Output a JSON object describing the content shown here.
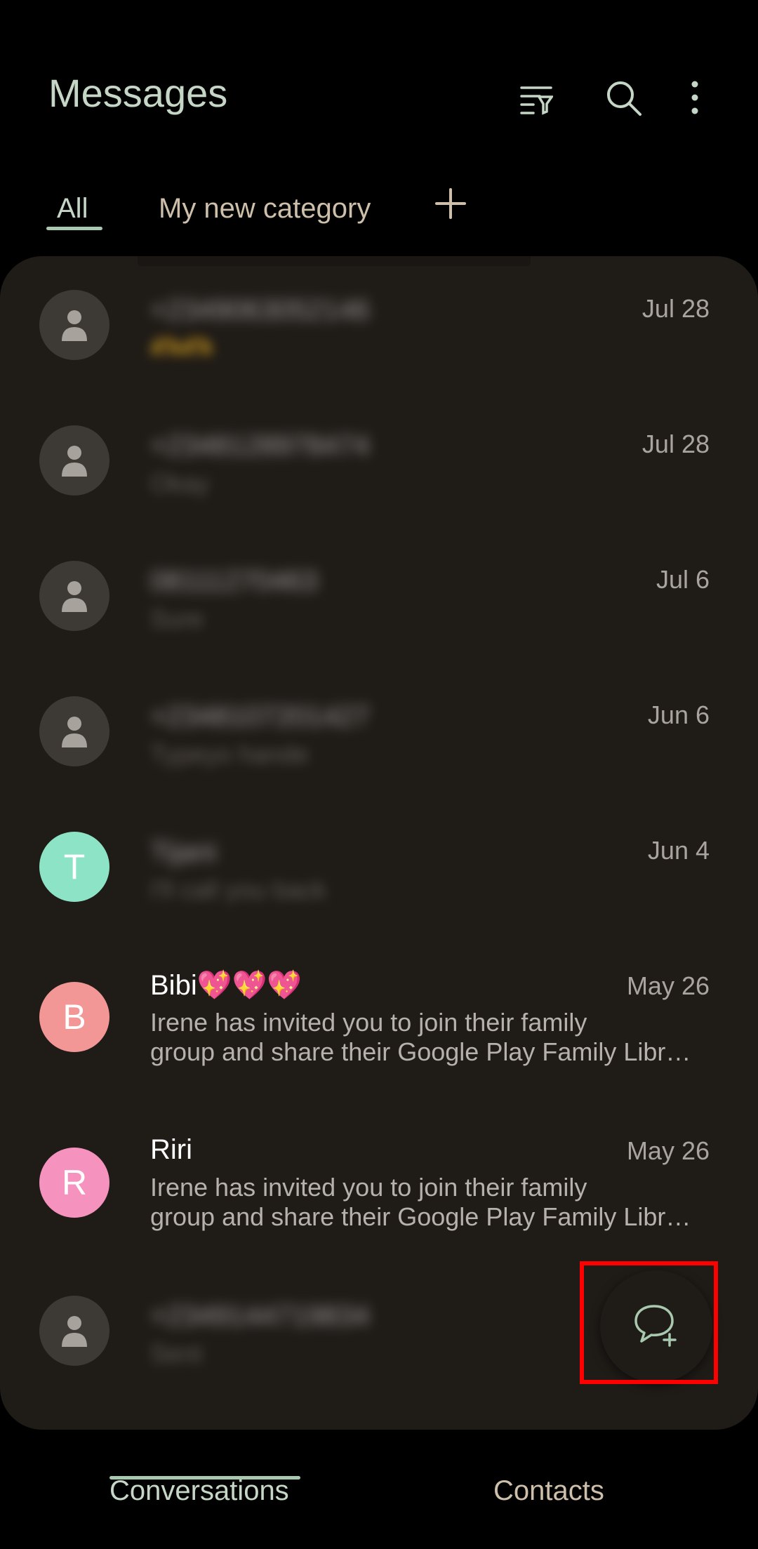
{
  "header": {
    "title": "Messages",
    "icons": [
      "filter-icon",
      "search-icon",
      "more-options-icon"
    ]
  },
  "tabs": [
    {
      "label": "All",
      "active": true
    },
    {
      "label": "My new category",
      "active": false
    }
  ],
  "add_category_icon": "plus-icon",
  "conversations": [
    {
      "name": "+2349063052146",
      "date": "Jul 28",
      "preview": "🫶🫶",
      "avatar": "person-icon",
      "blurred": true
    },
    {
      "name": "+2348128978474",
      "date": "Jul 28",
      "preview": "Okay",
      "avatar": "person-icon",
      "blurred": true
    },
    {
      "name": "08111270463",
      "date": "Jul 6",
      "preview": "Sure",
      "avatar": "person-icon",
      "blurred": true
    },
    {
      "name": "+2348107201427",
      "date": "Jun 6",
      "preview": "Typeyo hande",
      "avatar": "person-icon",
      "blurred": true
    },
    {
      "name": "Tijani",
      "date": "Jun 4",
      "preview": "I'll call you back",
      "avatar_letter": "T",
      "avatar_color": "#8de3c6",
      "blurred": true
    },
    {
      "name": "Bibi💖💖💖",
      "date": "May 26",
      "preview_line1": "Irene has invited you to join their family",
      "preview_line2": "group and share their Google Play Family Libr…",
      "avatar_letter": "B",
      "avatar_color": "#f29796",
      "blurred": false
    },
    {
      "name": "Riri",
      "date": "May 26",
      "preview_line1": "Irene has invited you to join their family",
      "preview_line2": "group and share their Google Play Family Libr…",
      "avatar_letter": "R",
      "avatar_color": "#f592bd",
      "blurred": false
    },
    {
      "name": "+2349144719834",
      "date": "",
      "preview": "Sent",
      "avatar": "person-icon",
      "blurred": true
    }
  ],
  "fab_icon": "new-chat-icon",
  "bottom_nav": [
    {
      "label": "Conversations",
      "active": true
    },
    {
      "label": "Contacts",
      "active": false
    }
  ],
  "colors": {
    "background": "#000000",
    "panel": "#1f1b17",
    "accent": "#c5d6c6",
    "highlight": "#ff0000"
  }
}
